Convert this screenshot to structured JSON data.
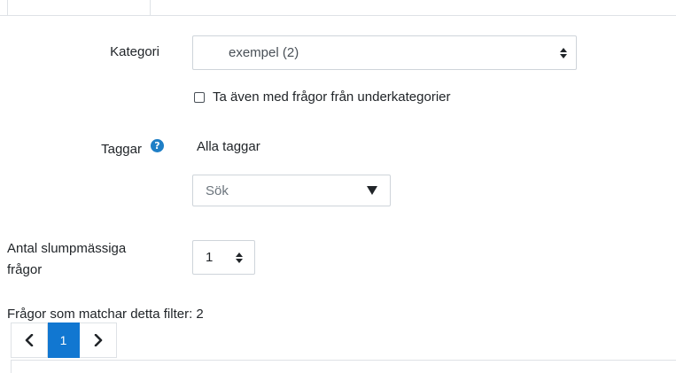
{
  "form": {
    "category_label": "Kategori",
    "category_value": "exempel (2)",
    "include_subcategories_label": "Ta även med frågor från underkategorier",
    "tags_label": "Taggar",
    "tags_value": "Alla taggar",
    "tag_search_placeholder": "Sök",
    "random_count_label_line1": "Antal slumpmässiga",
    "random_count_label_line2": "frågor",
    "random_count_value": "1"
  },
  "filter": {
    "matching_text": "Frågor som matchar detta filter: 2"
  },
  "pagination": {
    "current_page": "1"
  },
  "colors": {
    "accent": "#1177d1",
    "help_icon": "#1f7fc6",
    "border": "#ced4da"
  },
  "icons": {
    "help": "question-circle-icon",
    "sort": "sort-updown-icon",
    "dropdown": "triangle-down-icon",
    "prev": "chevron-left-icon",
    "next": "chevron-right-icon"
  }
}
